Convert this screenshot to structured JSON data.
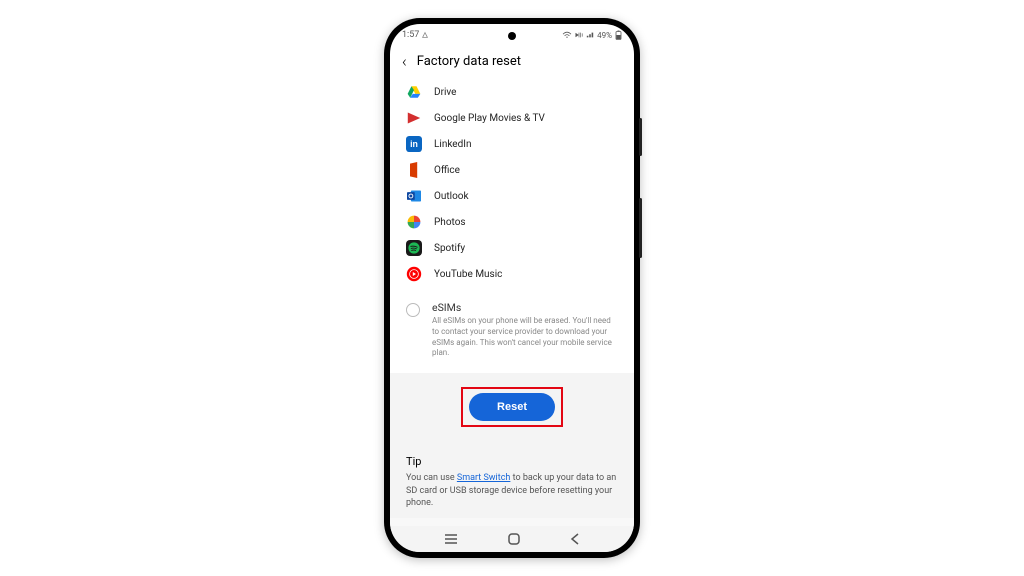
{
  "status": {
    "time": "1:57",
    "battery_pct": "49%"
  },
  "header": {
    "title": "Factory data reset"
  },
  "apps": [
    {
      "name": "Drive",
      "icon": "drive"
    },
    {
      "name": "Google Play Movies & TV",
      "icon": "playmovies"
    },
    {
      "name": "LinkedIn",
      "icon": "linkedin"
    },
    {
      "name": "Office",
      "icon": "office"
    },
    {
      "name": "Outlook",
      "icon": "outlook"
    },
    {
      "name": "Photos",
      "icon": "photos"
    },
    {
      "name": "Spotify",
      "icon": "spotify"
    },
    {
      "name": "YouTube Music",
      "icon": "ytmusic"
    }
  ],
  "esim": {
    "title": "eSIMs",
    "desc": "All eSIMs on your phone will be erased. You'll need to contact your service provider to download your eSIMs again. This won't cancel your mobile service plan."
  },
  "reset_button": "Reset",
  "tip": {
    "title": "Tip",
    "prefix": "You can use ",
    "link": "Smart Switch",
    "suffix": " to back up your data to an SD card or USB storage device before resetting your phone."
  }
}
